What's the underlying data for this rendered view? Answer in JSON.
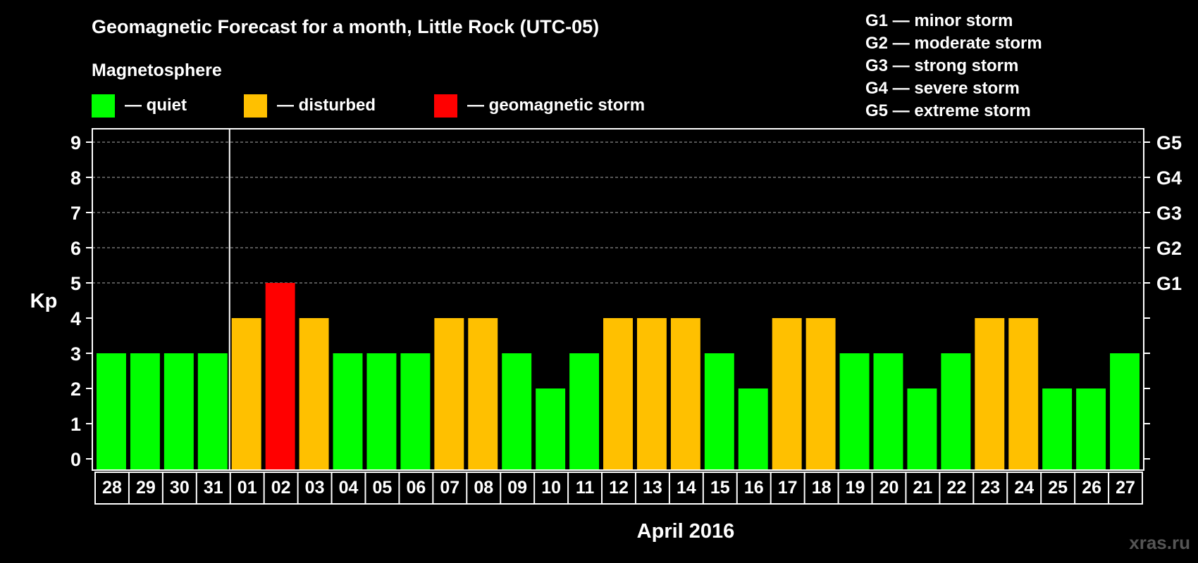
{
  "header": {
    "title": "Geomagnetic Forecast for a month, Little Rock (UTC-05)",
    "subtitle": "Magnetosphere"
  },
  "legend": [
    {
      "label": "— quiet",
      "color": "#00ff00"
    },
    {
      "label": "— disturbed",
      "color": "#ffc000"
    },
    {
      "label": "— geomagnetic storm",
      "color": "#ff0000"
    }
  ],
  "g_legend": [
    "G1 — minor storm",
    "G2 — moderate storm",
    "G3 — strong storm",
    "G4 — severe storm",
    "G5 — extreme storm"
  ],
  "watermark": "xras.ru",
  "chart_data": {
    "type": "bar",
    "title": "Geomagnetic Forecast for a month, Little Rock (UTC-05)",
    "ylabel": "Kp",
    "xlabel": "April 2016",
    "ylim": [
      0,
      9
    ],
    "yticks": [
      "0",
      "1",
      "2",
      "3",
      "4",
      "5",
      "6",
      "7",
      "8",
      "9"
    ],
    "right_axis_labels": [
      {
        "kp": 5,
        "label": "G1"
      },
      {
        "kp": 6,
        "label": "G2"
      },
      {
        "kp": 7,
        "label": "G3"
      },
      {
        "kp": 8,
        "label": "G4"
      },
      {
        "kp": 9,
        "label": "G5"
      }
    ],
    "grid_dashed_from": 5,
    "month_divider_after_index": 3,
    "categories": [
      "28",
      "29",
      "30",
      "31",
      "01",
      "02",
      "03",
      "04",
      "05",
      "06",
      "07",
      "08",
      "09",
      "10",
      "11",
      "12",
      "13",
      "14",
      "15",
      "16",
      "17",
      "18",
      "19",
      "20",
      "21",
      "22",
      "23",
      "24",
      "25",
      "26",
      "27"
    ],
    "values": [
      3,
      3,
      3,
      3,
      4,
      5,
      4,
      3,
      3,
      3,
      4,
      4,
      3,
      2,
      3,
      4,
      4,
      4,
      3,
      2,
      4,
      4,
      3,
      3,
      2,
      3,
      4,
      4,
      2,
      2,
      3
    ],
    "colors": {
      "quiet": "#00ff00",
      "disturbed": "#ffc000",
      "storm": "#ff0000"
    }
  }
}
